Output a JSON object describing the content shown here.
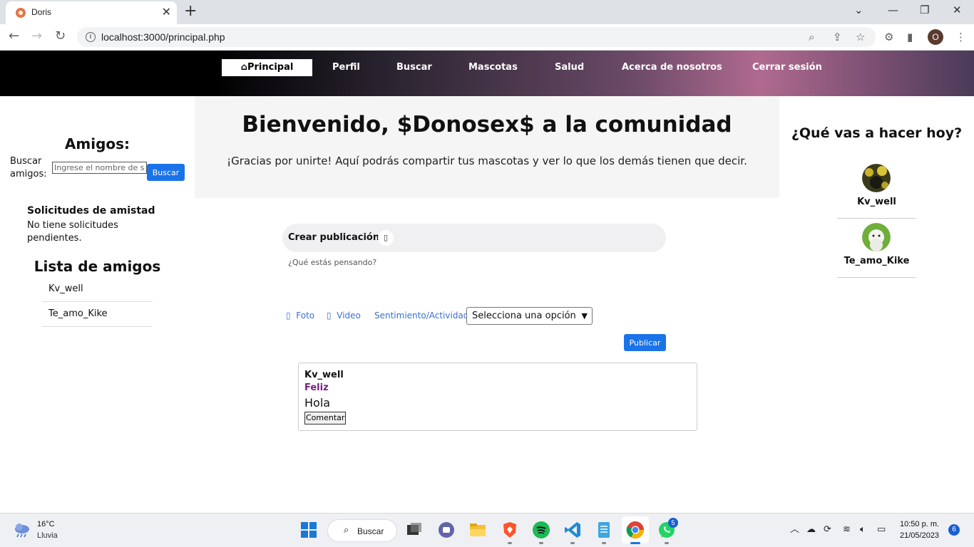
{
  "browser": {
    "tab_title": "Doris",
    "url": "localhost:3000/principal.php",
    "profile_initial": "O"
  },
  "nav": {
    "items": [
      "Principal",
      "Perfil",
      "Buscar",
      "Mascotas",
      "Salud",
      "Acerca de nosotros",
      "Cerrar sesión"
    ],
    "active": "Principal"
  },
  "left": {
    "friends_title": "Amigos:",
    "search_label": "Buscar amigos:",
    "search_placeholder": "Ingrese el nombre de su",
    "search_button": "Buscar",
    "requests_title": "Solicitudes de amistad",
    "requests_text": "No tiene solicitudes pendientes.",
    "list_title": "Lista de amigos",
    "friends": [
      "Kv_well",
      "Te_amo_Kike"
    ]
  },
  "hero": {
    "title": "Bienvenido, $Donosex$ a la comunidad",
    "subtitle": "¡Gracias por unirte! Aquí podrás compartir tus mascotas y ver lo que los demás tienen que decir."
  },
  "composer": {
    "title": "Crear publicación",
    "thought": "¿Qué estás pensando?",
    "photo": "Foto",
    "video": "Video",
    "feeling": "Sentimiento/Actividad",
    "select_value": "Selecciona una opción",
    "publish": "Publicar"
  },
  "post": {
    "author": "Kv_well",
    "mood": "Feliz",
    "text": "Hola",
    "comment": "Comentar"
  },
  "right": {
    "title": "¿Qué vas a hacer hoy?",
    "users": [
      "Kv_well",
      "Te_amo_Kike"
    ]
  },
  "taskbar": {
    "temp": "16°C",
    "weather": "Lluvia",
    "search": "Buscar",
    "whatsapp_badge": "5",
    "time": "10:50 p. m.",
    "date": "21/05/2023",
    "notifications": "6"
  },
  "colors": {
    "accent": "#1a73e8",
    "mood": "#7a1f86"
  }
}
